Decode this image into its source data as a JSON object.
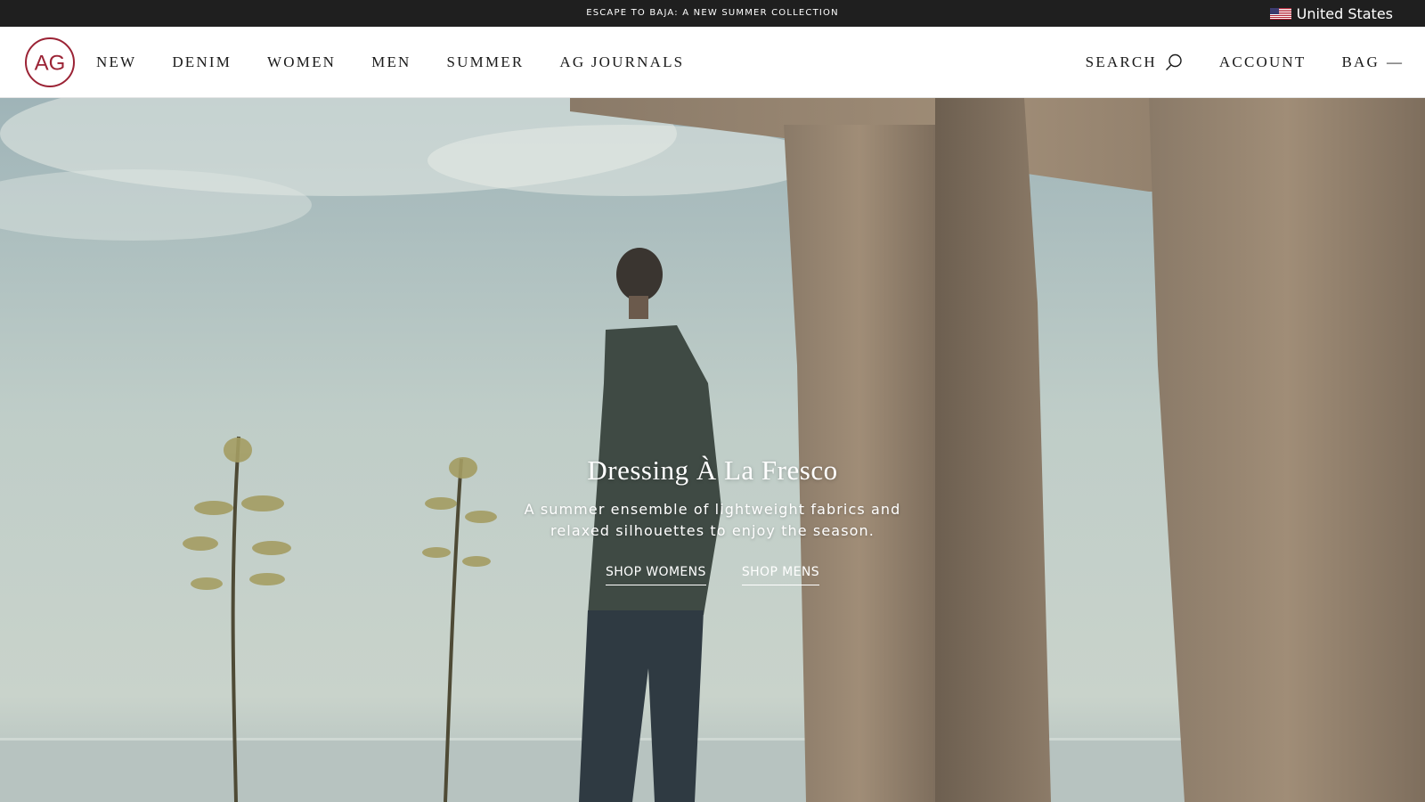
{
  "announcement": {
    "text": "ESCAPE TO BAJA: A NEW SUMMER COLLECTION",
    "region_label": "United States",
    "region_icon": "us-flag-icon"
  },
  "brand": {
    "logo_text": "AG",
    "accent_color": "#9b2335"
  },
  "nav": {
    "items": [
      {
        "label": "NEW"
      },
      {
        "label": "DENIM"
      },
      {
        "label": "WOMEN"
      },
      {
        "label": "MEN"
      },
      {
        "label": "SUMMER"
      },
      {
        "label": "AG JOURNALS"
      }
    ]
  },
  "utilities": {
    "search_label": "SEARCH",
    "search_icon": "search-icon",
    "account_label": "ACCOUNT",
    "bag_label": "BAG",
    "bag_count": "—"
  },
  "hero": {
    "title": "Dressing À La Fresco",
    "subtitle": "A summer ensemble of lightweight fabrics and relaxed silhouettes to enjoy the season.",
    "cta_women": "SHOP WOMENS",
    "cta_men": "SHOP MENS"
  }
}
